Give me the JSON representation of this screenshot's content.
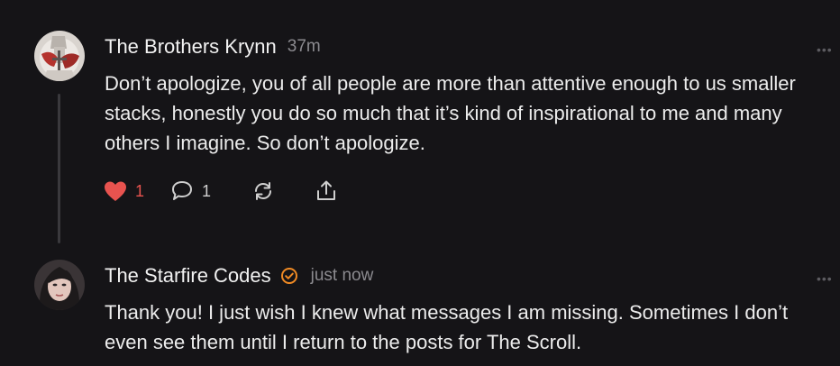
{
  "comments": [
    {
      "author": "The Brothers Krynn",
      "time": "37m",
      "verified": false,
      "body": "Don’t apologize, you of all people are more than attentive enough to us smaller stacks, honestly you do so much that it’s kind of inspirational to me and many others I imagine. So don’t apologize.",
      "likes": "1",
      "replies": "1",
      "more_label": "•••"
    },
    {
      "author": "The Starfire Codes",
      "time": "just now",
      "verified": true,
      "body": "Thank you! I just wish I knew what messages I am missing. Sometimes I don’t even see them until I return to the posts for The Scroll.",
      "more_label": "•••"
    }
  ],
  "colors": {
    "background": "#151417",
    "like": "#e8534f",
    "verified": "#f08a24",
    "muted": "#8b8a8f"
  },
  "icons": {
    "like": "heart-icon",
    "reply": "comment-bubble-icon",
    "restack": "restack-icon",
    "share": "share-icon",
    "verified": "verified-badge-icon",
    "more": "more-dots-icon"
  }
}
